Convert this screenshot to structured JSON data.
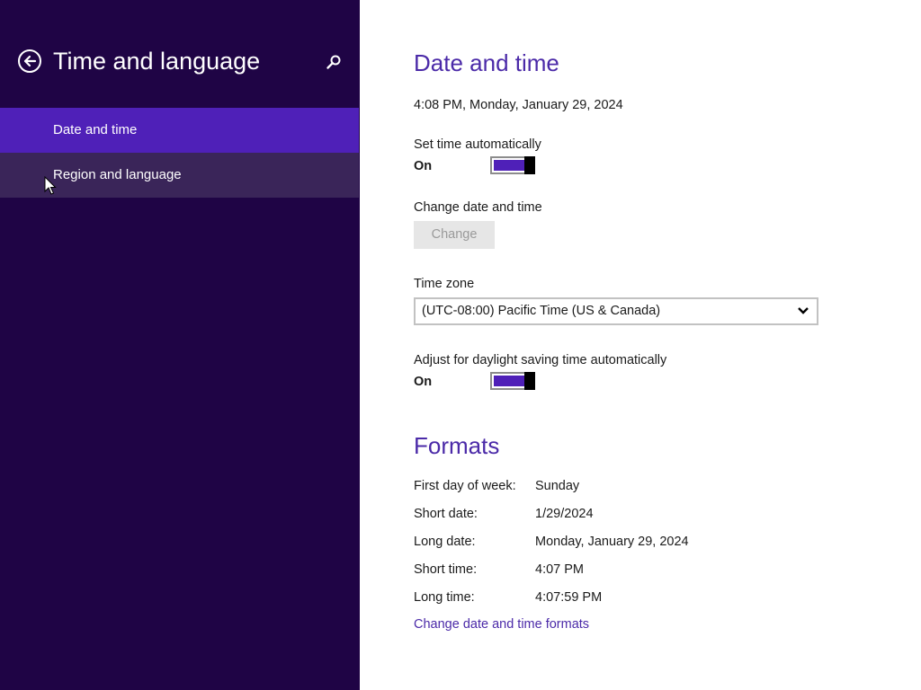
{
  "sidebar": {
    "title": "Time and language",
    "back_icon": "back-arrow-icon",
    "search_icon": "search-icon",
    "items": [
      {
        "label": "Date and time",
        "state": "selected"
      },
      {
        "label": "Region and language",
        "state": "hover"
      }
    ]
  },
  "date_time": {
    "heading": "Date and time",
    "current": "4:08 PM, Monday, January 29, 2024",
    "set_auto_label": "Set time automatically",
    "set_auto_state": "On",
    "change_label": "Change date and time",
    "change_button": "Change",
    "timezone_label": "Time zone",
    "timezone_value": "(UTC-08:00) Pacific Time (US & Canada)",
    "dst_label": "Adjust for daylight saving time automatically",
    "dst_state": "On"
  },
  "formats": {
    "heading": "Formats",
    "rows": [
      {
        "label": "First day of week:",
        "value": "Sunday"
      },
      {
        "label": "Short date:",
        "value": "1/29/2024"
      },
      {
        "label": "Long date:",
        "value": "Monday, January 29, 2024"
      },
      {
        "label": "Short time:",
        "value": "4:07 PM"
      },
      {
        "label": "Long time:",
        "value": "4:07:59 PM"
      }
    ],
    "link": "Change date and time formats"
  },
  "colors": {
    "sidebar_bg": "#1f0445",
    "selected_item_bg": "#4f20b8",
    "hover_item_bg": "#3a2559",
    "accent": "#4b2aa8"
  }
}
